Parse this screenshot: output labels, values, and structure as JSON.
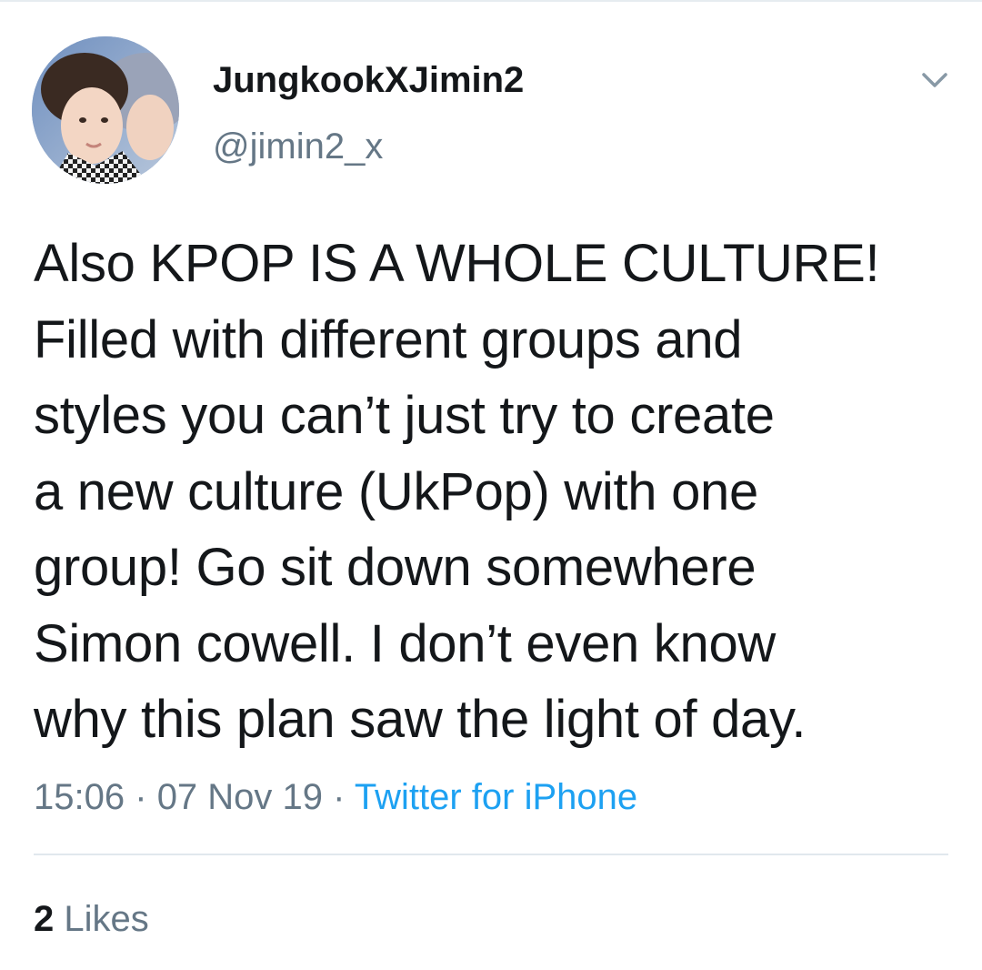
{
  "tweet": {
    "author": {
      "display_name": "JungkookXJimin2",
      "handle": "@jimin2_x",
      "avatar_icon": "profile-photo"
    },
    "menu_icon": "chevron-down-icon",
    "text_lines": [
      "Also KPOP IS A WHOLE CULTURE!",
      "Filled with different groups and",
      "styles you can’t just try to create",
      "a new culture (UkPop) with one",
      "group! Go sit down somewhere",
      "Simon cowell. I don’t even know",
      "why this plan saw the light of day."
    ],
    "time": "15:06",
    "separator": "·",
    "date": "07 Nov 19",
    "source": "Twitter for iPhone",
    "likes_count": "2",
    "likes_label": "Likes"
  },
  "colors": {
    "text_primary": "#14171a",
    "text_secondary": "#657786",
    "link": "#1da1f2",
    "divider": "#e1e8ed"
  }
}
